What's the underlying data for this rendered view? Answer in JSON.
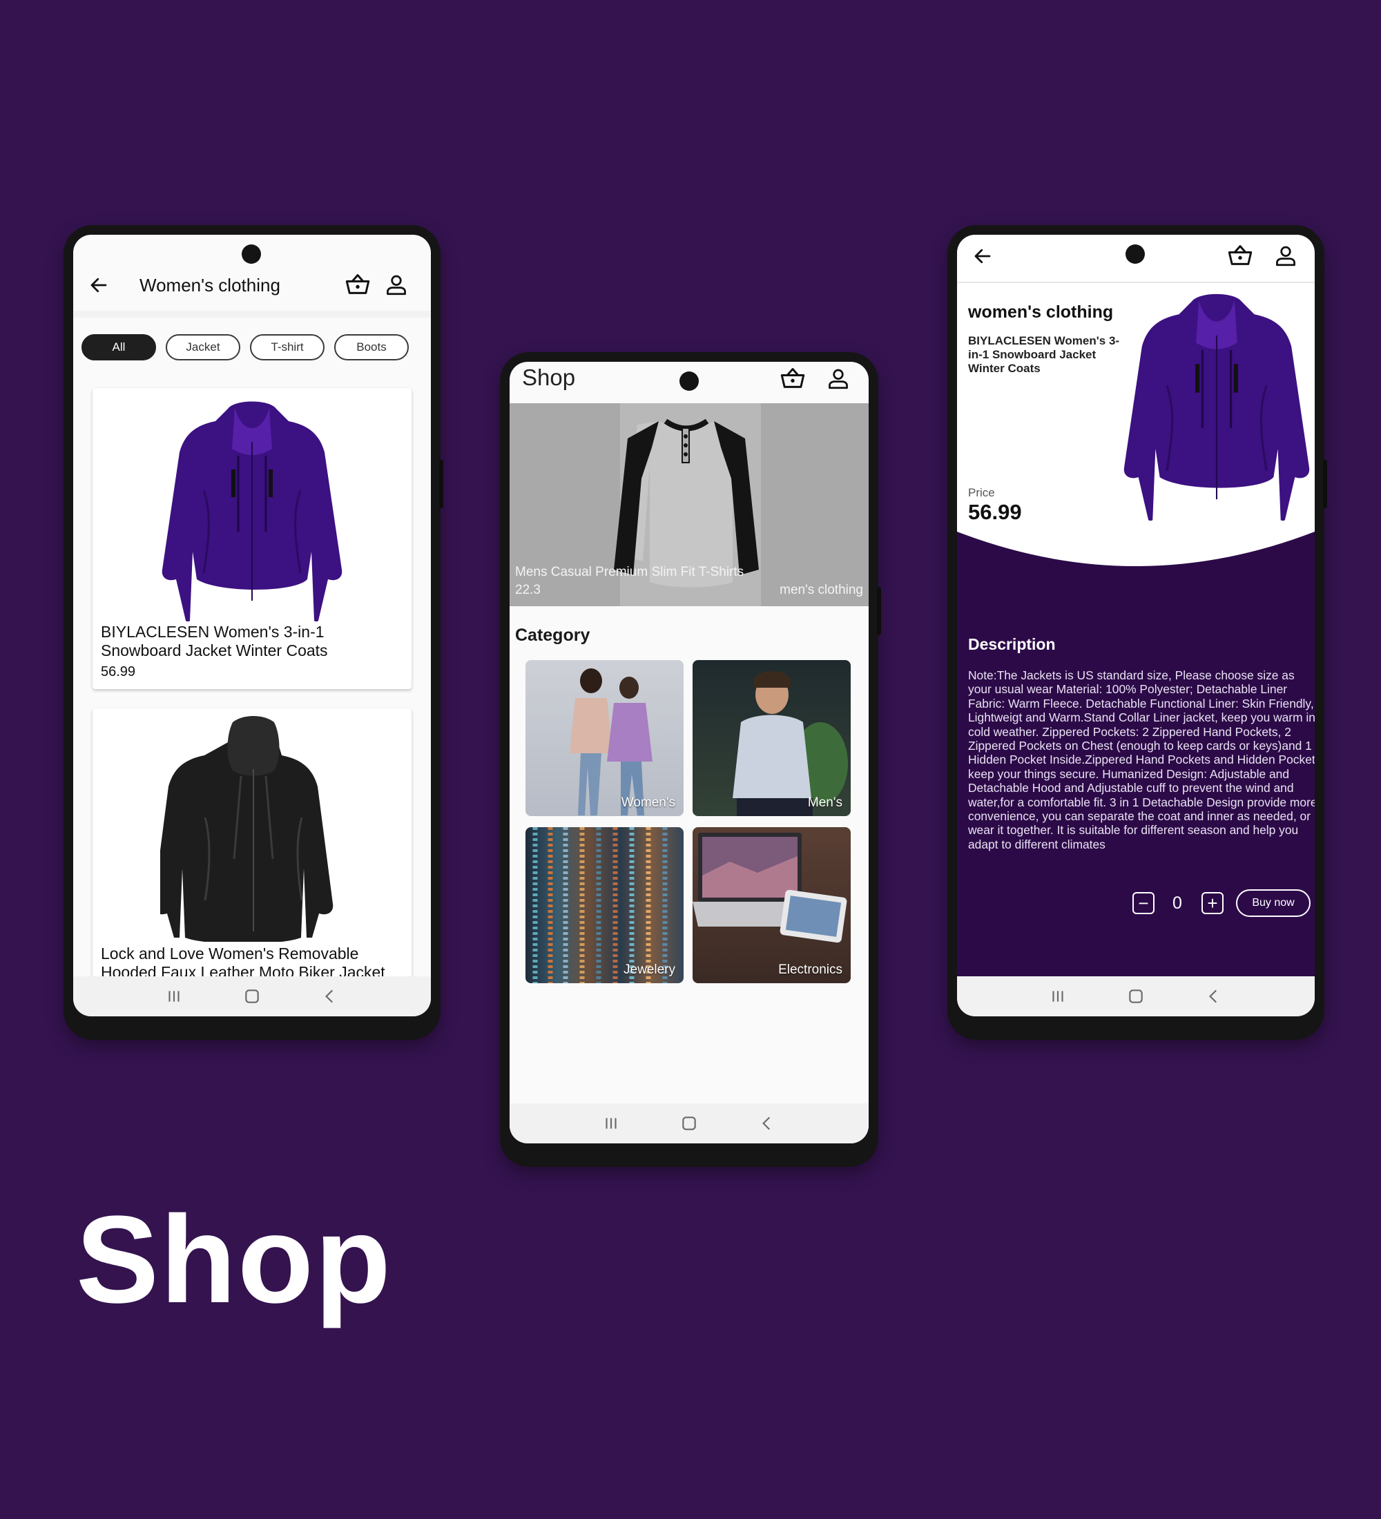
{
  "colors": {
    "background": "#34134f",
    "accent_purple": "#2c0a48",
    "chip_active": "#1f1f1f"
  },
  "phone_list": {
    "title": "Women's clothing",
    "filters": [
      {
        "label": "All",
        "active": true
      },
      {
        "label": "Jacket",
        "active": false
      },
      {
        "label": "T-shirt",
        "active": false
      },
      {
        "label": "Boots",
        "active": false
      }
    ],
    "products": [
      {
        "title": "BIYLACLESEN Women's 3-in-1 Snowboard Jacket Winter Coats",
        "price": "56.99",
        "image": "purple-jacket"
      },
      {
        "title": "Lock and Love Women's Removable Hooded Faux Leather Moto Biker Jacket",
        "price": "",
        "image": "black-leather-jacket"
      }
    ]
  },
  "phone_shop": {
    "title": "Shop",
    "banner": {
      "product_title": "Mens Casual Premium Slim Fit T-Shirts",
      "price": "22.3",
      "category": "men's clothing",
      "image": "raglan-tshirt"
    },
    "category_heading": "Category",
    "categories": [
      {
        "label": "Women's",
        "image": "women-photo"
      },
      {
        "label": "Men's",
        "image": "men-photo"
      },
      {
        "label": "Jewelery",
        "image": "beads-photo"
      },
      {
        "label": "Electronics",
        "image": "laptop-photo"
      }
    ]
  },
  "phone_detail": {
    "category": "women's clothing",
    "product_title": "BIYLACLESEN Women's 3-in-1 Snowboard Jacket Winter Coats",
    "price_label": "Price",
    "price": "56.99",
    "description_heading": "Description",
    "description": "Note:The Jackets is US standard size, Please choose size as your usual wear Material: 100% Polyester; Detachable Liner Fabric: Warm Fleece. Detachable Functional Liner: Skin Friendly, Lightweigt and Warm.Stand Collar Liner jacket, keep you warm in cold weather. Zippered Pockets: 2 Zippered Hand Pockets, 2 Zippered Pockets on Chest (enough to keep cards or keys)and 1 Hidden Pocket Inside.Zippered Hand Pockets and Hidden Pocket keep your things secure. Humanized Design: Adjustable and Detachable Hood and Adjustable cuff to prevent the wind and water,for a comfortable fit. 3 in 1 Detachable Design provide more convenience, you can separate the coat and inner as needed, or wear it together. It is suitable for different season and help you adapt to different climates",
    "quantity": "0",
    "buy_label": "Buy now",
    "decrement_symbol": "−",
    "increment_symbol": "+"
  },
  "page_title": "Shop",
  "icons": [
    "back-arrow-icon",
    "basket-icon",
    "user-icon",
    "recents-icon",
    "home-icon",
    "back-nav-icon"
  ]
}
